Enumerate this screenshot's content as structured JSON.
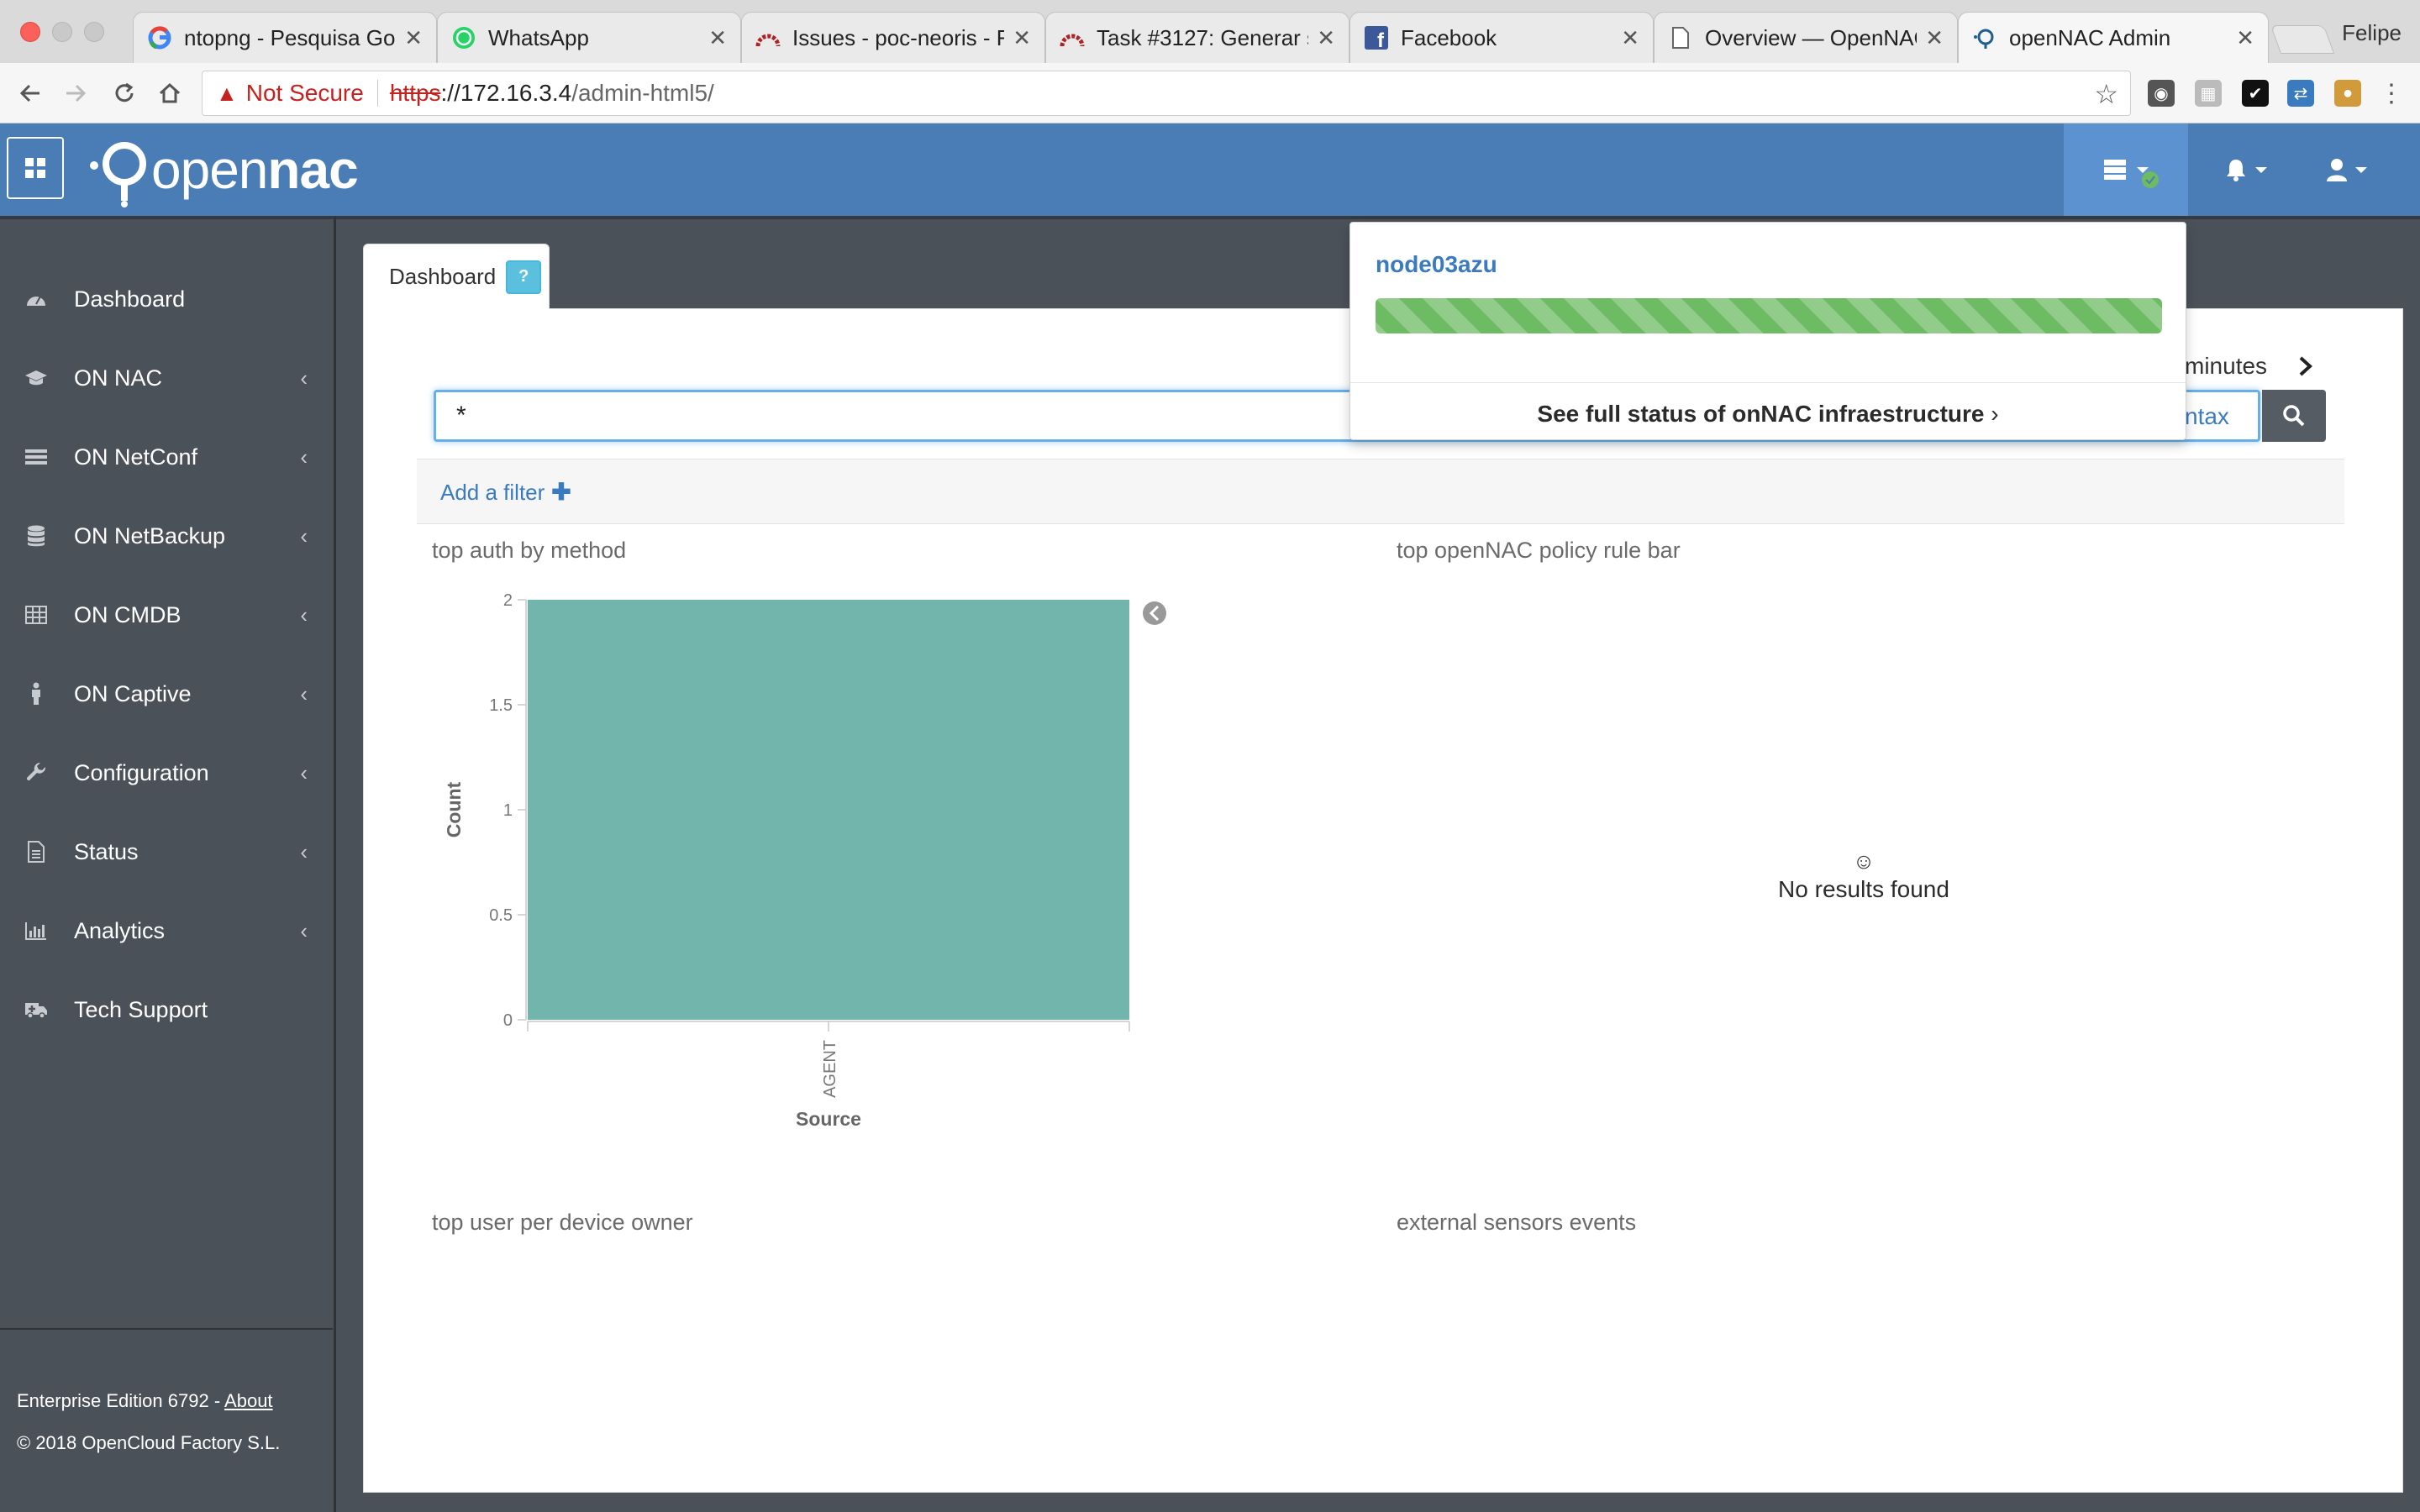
{
  "browser": {
    "tabs": [
      {
        "title": "ntopng - Pesquisa Goo",
        "icon": "google-icon"
      },
      {
        "title": "WhatsApp",
        "icon": "whatsapp-icon"
      },
      {
        "title": "Issues - poc-neoris - F",
        "icon": "redmine-icon"
      },
      {
        "title": "Task #3127: Generar s",
        "icon": "redmine-icon"
      },
      {
        "title": "Facebook",
        "icon": "facebook-icon"
      },
      {
        "title": "Overview — OpenNAC",
        "icon": "document-icon"
      },
      {
        "title": "openNAC Admin",
        "icon": "opennac-icon"
      }
    ],
    "profile_name": "Felipe",
    "address": {
      "security_label": "Not Secure",
      "scheme": "https",
      "host": "://172.16.3.4",
      "path": "/admin-html5/"
    }
  },
  "header": {
    "logo_light": "open",
    "logo_bold": "nac",
    "accent_color": "#4a7db5"
  },
  "sidebar": {
    "items": [
      {
        "label": "Dashboard",
        "icon": "dashboard-icon",
        "has_submenu": false
      },
      {
        "label": "ON NAC",
        "icon": "graduation-cap-icon",
        "has_submenu": true
      },
      {
        "label": "ON NetConf",
        "icon": "list-icon",
        "has_submenu": true
      },
      {
        "label": "ON NetBackup",
        "icon": "database-icon",
        "has_submenu": true
      },
      {
        "label": "ON CMDB",
        "icon": "table-icon",
        "has_submenu": true
      },
      {
        "label": "ON Captive",
        "icon": "person-icon",
        "has_submenu": true
      },
      {
        "label": "Configuration",
        "icon": "wrench-icon",
        "has_submenu": true
      },
      {
        "label": "Status",
        "icon": "file-icon",
        "has_submenu": true
      },
      {
        "label": "Analytics",
        "icon": "bar-chart-icon",
        "has_submenu": true
      },
      {
        "label": "Tech Support",
        "icon": "ambulance-icon",
        "has_submenu": false
      }
    ],
    "footer": {
      "edition": "Enterprise Edition 6792 - ",
      "about_link": "About",
      "copyright": "© 2018 OpenCloud Factory S.L."
    }
  },
  "main": {
    "tab_label": "Dashboard",
    "help_badge": "?",
    "time_range_suffix": "minutes",
    "search_value": "*",
    "syntax_link": "ntax",
    "add_filter_label": "Add a filter",
    "visualizations": [
      {
        "title": "top auth by method"
      },
      {
        "title": "top openNAC policy rule bar",
        "empty_message": "No results found"
      },
      {
        "title": "top user per device owner"
      },
      {
        "title": "external sensors events"
      }
    ]
  },
  "status_dropdown": {
    "node_name": "node03azu",
    "progress": 1.0,
    "progress_color": "#6dbb63",
    "full_status_link": "See full status of onNAC infraestructure"
  },
  "chart_data": {
    "type": "bar",
    "categories": [
      "AGENT"
    ],
    "values": [
      2
    ],
    "xlabel": "Source",
    "ylabel": "Count",
    "ylim": [
      0,
      2
    ],
    "yticks": [
      "0",
      "0.5",
      "1",
      "1.5",
      "2"
    ],
    "bar_color": "#72b5ad",
    "legend_toggle_icon": "chevron-left-circle-icon"
  }
}
